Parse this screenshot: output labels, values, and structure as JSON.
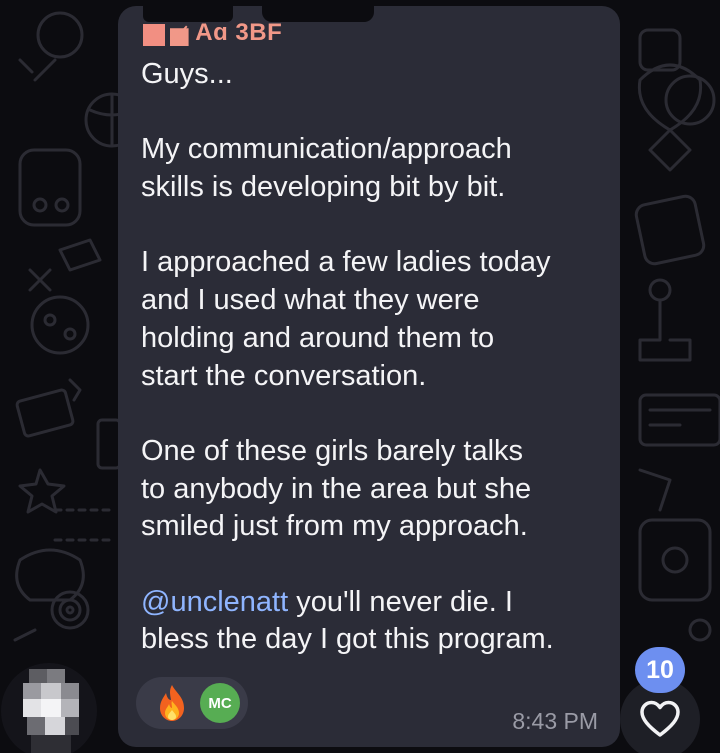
{
  "message": {
    "sender_name": "▅̷̷ Aɑ    3BF",
    "lines": [
      "Guys...",
      "",
      "My communication/approach",
      "skills is developing bit by bit.",
      "",
      "I approached a few ladies today",
      "and I used what they were",
      "holding and around them to",
      "start the conversation.",
      "",
      "One of these girls barely talks",
      "to anybody in the area but she",
      "smiled just from my approach.",
      ""
    ],
    "mention": "@unclenatt",
    "mention_tail": " you'll never die. I",
    "last_line": "bless the day I got this program.",
    "time": "8:43 PM"
  },
  "reactions": {
    "emoji": "fire-icon",
    "reactor_initials": "MC"
  },
  "unread_count": "10",
  "icons": {
    "react_button": "heart-icon"
  },
  "colors": {
    "bubble": "#2b2c37",
    "sender_name": "#f19888",
    "mention": "#8fb5ff",
    "badge": "#6d8ff0",
    "reactor_avatar": "#57ad53"
  }
}
